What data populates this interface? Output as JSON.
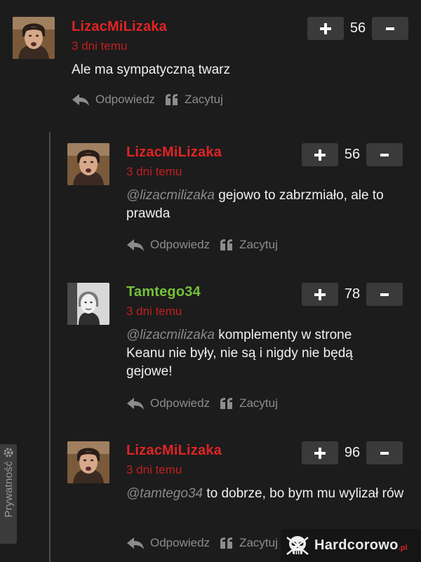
{
  "comments": [
    {
      "author": "LizacMiLizaka",
      "time": "3 dni temu",
      "mention": "",
      "text": "Ale ma sympatyczną twarz",
      "votes": "56",
      "reply_label": "Odpowiedz",
      "quote_label": "Zacytuj"
    },
    {
      "author": "LizacMiLizaka",
      "time": "3 dni temu",
      "mention": "@lizacmilizaka",
      "text": " gejowo to zabrzmiało, ale to prawda",
      "votes": "56",
      "reply_label": "Odpowiedz",
      "quote_label": "Zacytuj"
    },
    {
      "author": "Tamtego34",
      "time": "3 dni temu",
      "mention": "@lizacmilizaka",
      "text": " komplementy w strone Keanu nie były, nie są i nigdy nie będą gejowe!",
      "votes": "78",
      "reply_label": "Odpowiedz",
      "quote_label": "Zacytuj"
    },
    {
      "author": "LizacMiLizaka",
      "time": "3 dni temu",
      "mention": "@tamtego34",
      "text": " to dobrze, bo bym mu wylizał rów",
      "votes": "96",
      "reply_label": "Odpowiedz",
      "quote_label": "Zacytuj"
    }
  ],
  "privacy_label": "Prywatność",
  "watermark": {
    "brand": "Hardcorowo",
    "tld": ".pl"
  },
  "colors": {
    "background": "#1c1c1c",
    "author_red": "#e02424",
    "author_green": "#74c23a",
    "time_red": "#c21f1f",
    "vote_button": "#3a3a3a"
  },
  "icons": [
    "plus-icon",
    "minus-icon",
    "reply-arrow-icon",
    "quote-icon",
    "gear-icon",
    "skull-logo-icon"
  ]
}
